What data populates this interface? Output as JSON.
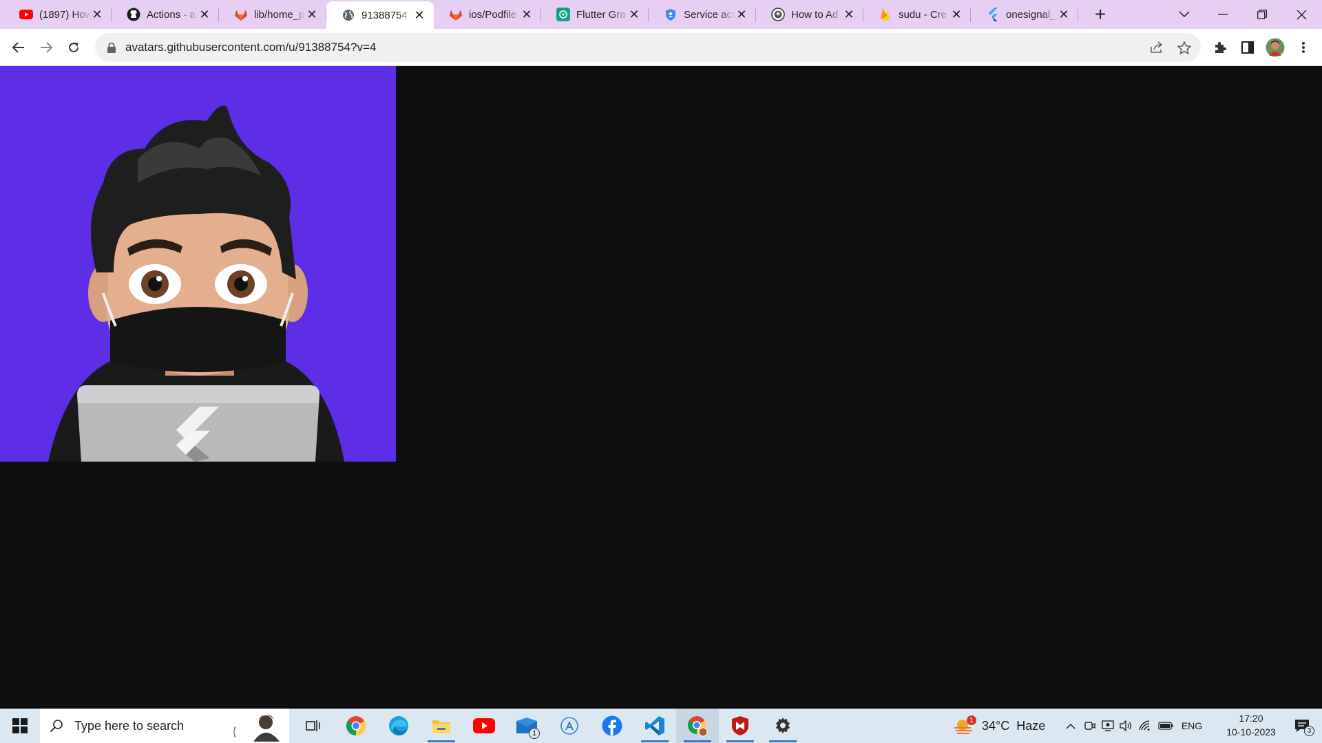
{
  "browser": {
    "tabs": [
      {
        "title": "(1897) How",
        "favicon": "youtube-icon"
      },
      {
        "title": "Actions · a",
        "favicon": "github-icon"
      },
      {
        "title": "lib/home_p",
        "favicon": "gitlab-icon"
      },
      {
        "title": "91388754",
        "favicon": "globe-icon",
        "active": true
      },
      {
        "title": "ios/Podfile",
        "favicon": "gitlab-icon"
      },
      {
        "title": "Flutter Gra",
        "favicon": "openai-icon"
      },
      {
        "title": "Service acc",
        "favicon": "shield-icon"
      },
      {
        "title": "How to Ad",
        "favicon": "github-avatar-icon"
      },
      {
        "title": "sudu - Cre",
        "favicon": "firebase-icon"
      },
      {
        "title": "onesignal_",
        "favicon": "flutter-icon"
      }
    ],
    "url": "avatars.githubusercontent.com/u/91388754?v=4"
  },
  "content": {
    "image": "github-avatar",
    "background_color": "#5d2ee6"
  },
  "taskbar": {
    "search_placeholder": "Type here to search",
    "mail_badge": "1",
    "weather": {
      "temp": "34°C",
      "condition": "Haze",
      "badge": "1"
    },
    "language": "ENG",
    "time": "17:20",
    "date": "10-10-2023",
    "notification_count": "3"
  },
  "colors": {
    "tabstrip": "#e7cff3",
    "avatar_bg": "#5d2ee6",
    "page_bg": "#0e0e0e",
    "taskbar": "#dbe7f1"
  }
}
